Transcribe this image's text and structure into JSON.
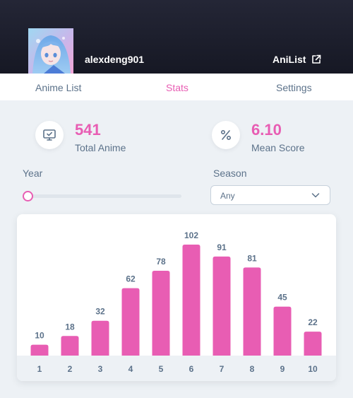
{
  "header": {
    "username": "alexdeng901",
    "external_link_label": "AniList",
    "avatar_icon": "anime-character-avatar",
    "external_icon": "external-link-icon"
  },
  "tabs": [
    {
      "label": "Anime List",
      "active": false
    },
    {
      "label": "Stats",
      "active": true
    },
    {
      "label": "Settings",
      "active": false
    }
  ],
  "stats": {
    "total": {
      "value": "541",
      "label": "Total Anime",
      "icon": "monitor-check-icon"
    },
    "mean": {
      "value": "6.10",
      "label": "Mean Score",
      "icon": "percent-icon"
    }
  },
  "filters": {
    "year_label": "Year",
    "year_slider_fraction": 0,
    "season_label": "Season",
    "season_value": "Any"
  },
  "colors": {
    "accent": "#e85db3",
    "header_bg": "#1b1d2b",
    "text": "#5c728a",
    "page_bg": "#edf1f5"
  },
  "chart_data": {
    "type": "bar",
    "categories": [
      "1",
      "2",
      "3",
      "4",
      "5",
      "6",
      "7",
      "8",
      "9",
      "10"
    ],
    "values": [
      10,
      18,
      32,
      62,
      78,
      102,
      91,
      81,
      45,
      22
    ],
    "color": "#e85db3",
    "xlabel": "",
    "ylabel": "",
    "data_labels": true,
    "grid": false
  }
}
